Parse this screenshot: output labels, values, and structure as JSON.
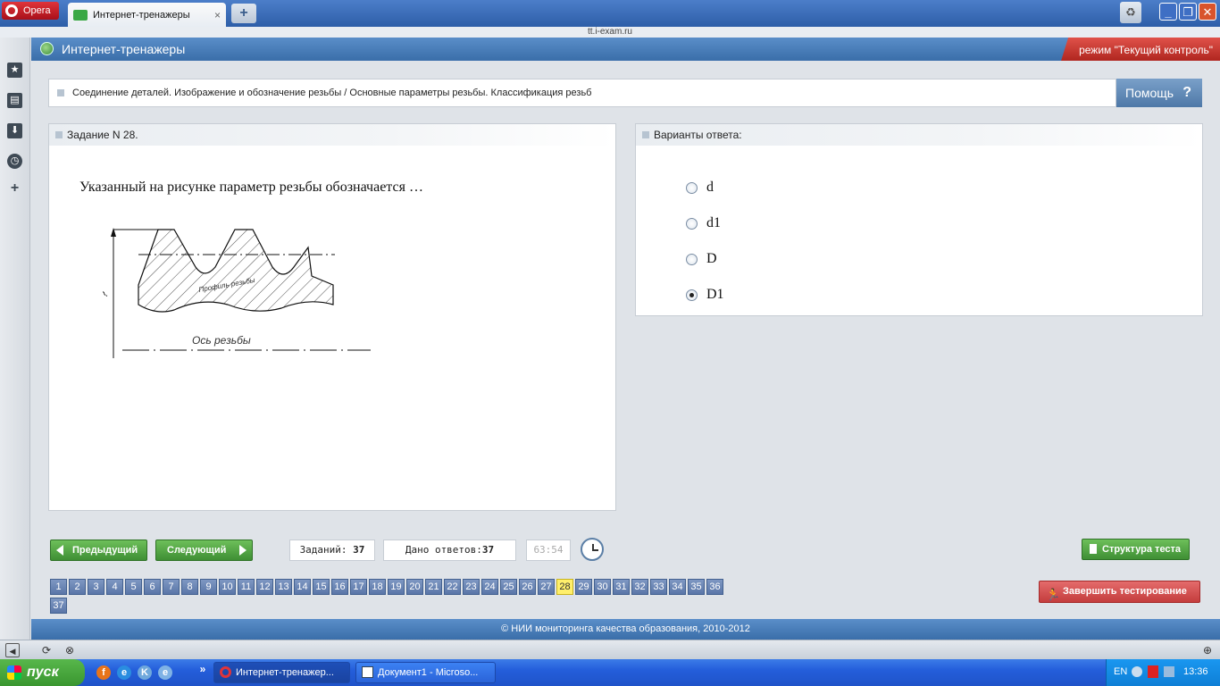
{
  "browser": {
    "menu_label": "Opera",
    "tab_title": "Интернет-тренажеры",
    "tab_close": "×",
    "new_tab": "+",
    "url": "tt.i-exam.ru",
    "window_controls": {
      "minimize": "_",
      "maximize": "❐",
      "close": "✕"
    }
  },
  "sidebar": {
    "icons": [
      "bookmarks-icon",
      "notes-icon",
      "downloads-icon",
      "history-icon",
      "add-panel-icon"
    ]
  },
  "app": {
    "title": "Интернет-тренажеры",
    "mode": "режим \"Текущий контроль\"",
    "topic": "Соединение деталей. Изображение и обозначение резьбы / Основные параметры резьбы. Классификация резьб",
    "help_label": "Помощь",
    "help_icon": "?"
  },
  "task": {
    "title": "Задание N 28.",
    "question": "Указанный на рисунке параметр резьбы обозначается …",
    "figure_label_axis": "Ось резьбы",
    "figure_label_profile": "Профиль резьбы",
    "figure_label_dim": "?"
  },
  "answers": {
    "title": "Варианты ответа:",
    "options": [
      {
        "label": "d",
        "checked": false
      },
      {
        "label": "d1",
        "checked": false
      },
      {
        "label": "D",
        "checked": false
      },
      {
        "label": "D1",
        "checked": true
      }
    ]
  },
  "controls": {
    "prev_label": "Предыдущий",
    "next_label": "Следующий",
    "tasks_label": "Заданий:",
    "tasks_count": "37",
    "answered_label": "Дано ответов:",
    "answered_count": "37",
    "timer": "63:54",
    "structure_label": "Структура теста",
    "finish_label": "Завершить тестирование"
  },
  "pager": {
    "pages": [
      "1",
      "2",
      "3",
      "4",
      "5",
      "6",
      "7",
      "8",
      "9",
      "10",
      "11",
      "12",
      "13",
      "14",
      "15",
      "16",
      "17",
      "18",
      "19",
      "20",
      "21",
      "22",
      "23",
      "24",
      "25",
      "26",
      "27",
      "28",
      "29",
      "30",
      "31",
      "32",
      "33",
      "34",
      "35",
      "36",
      "37"
    ],
    "current": "28"
  },
  "footer": {
    "copyright": "© НИИ мониторинга качества образования, 2010-2012"
  },
  "taskbar": {
    "start_label": "пуск",
    "tasks": [
      "Интернет-тренажер...",
      "Документ1 - Microso..."
    ],
    "lang": "EN",
    "time": "13:36"
  },
  "colors": {
    "header_blue": "#3a6ea9",
    "mode_red": "#b0261f",
    "green_button": "#3f8f34",
    "finish_red": "#c43d3d",
    "current_page": "#ffef6b"
  }
}
